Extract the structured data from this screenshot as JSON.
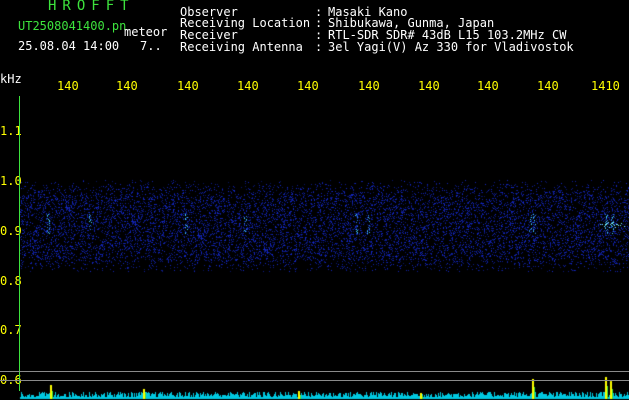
{
  "header": {
    "title": "HROFFT",
    "file_name": "UT2508041400.pn",
    "date_time": "25.08.04 14:00",
    "meteor_label": "meteor",
    "sv_value": "7..",
    "rows": [
      {
        "label": "Observer",
        "colon": ":",
        "value": "Masaki Kano"
      },
      {
        "label": "Receiving Location",
        "colon": ":",
        "value": "Shibukawa, Gunma, Japan"
      },
      {
        "label": "Receiver",
        "colon": ":",
        "value": "RTL-SDR SDR# 43dB L15 103.2MHz CW"
      },
      {
        "label": "Receiving Antenna",
        "colon": ":",
        "value": "3el Yagi(V) Az 330 for Vladivostok"
      }
    ]
  },
  "axes": {
    "y_unit": "kHz",
    "y_ticks": [
      "1.1",
      "1.0",
      "0.9",
      "0.8",
      "0.7",
      "0.6"
    ],
    "x_ticks": [
      "140",
      "140",
      "140",
      "140",
      "140",
      "140",
      "140",
      "140",
      "140",
      "1410"
    ]
  },
  "colors": {
    "green": "#3de33d",
    "white": "#ffffff",
    "yellow": "#ffff00",
    "noise": "#1a2a9a",
    "signal": "#40d0ff",
    "spectrum_line": "#00c8e0"
  }
}
